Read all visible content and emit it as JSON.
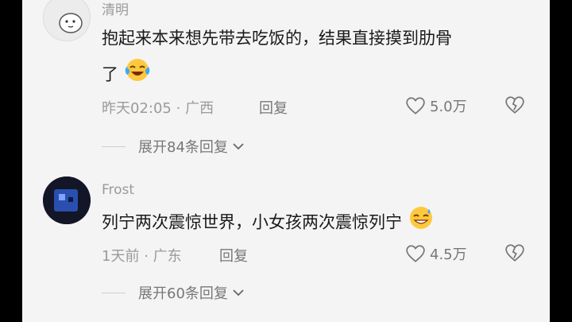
{
  "comments": [
    {
      "username": "清明",
      "text_line1": "抱起来本来想先带去吃饭的，结果直接摸到肋骨",
      "text_line2": "了",
      "emoji": "crying-laughing-emoji",
      "time": "昨天02:05",
      "location": "广西",
      "reply_label": "回复",
      "likes": "5.0万",
      "expand_label": "展开84条回复"
    },
    {
      "username": "Frost",
      "text_line1": "列宁两次震惊世界，小女孩两次震惊列宁",
      "emoji": "grinning-sweat-emoji",
      "time": "1天前",
      "location": "广东",
      "reply_label": "回复",
      "likes": "4.5万",
      "expand_label": "展开60条回复"
    }
  ],
  "separator": "·",
  "colors": {
    "background": "#f4f4f4",
    "text": "#1a1a1a",
    "meta": "#9a9a9a"
  }
}
